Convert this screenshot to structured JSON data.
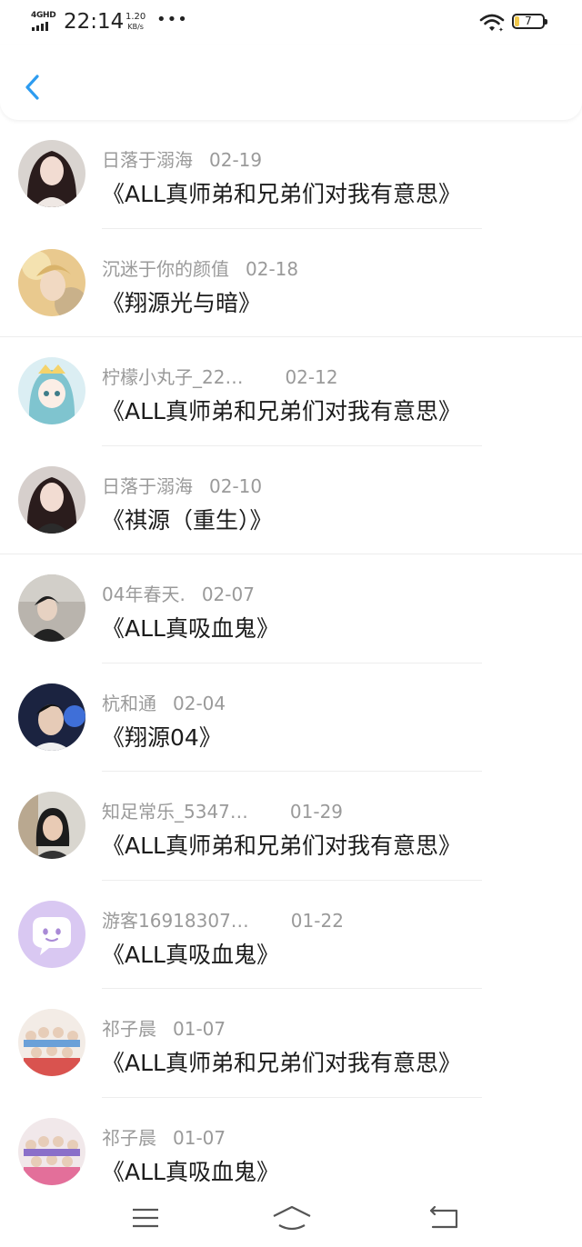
{
  "status_bar": {
    "network": "4GHD",
    "time": "22:14",
    "speed_value": "1.20",
    "speed_unit": "KB/s",
    "more_icon": "ellipsis-icon",
    "wifi_icon": "wifi-icon",
    "battery_level": "7"
  },
  "header": {
    "back_icon": "chevron-left-icon",
    "accent_color": "#2d9cf0"
  },
  "comments": [
    {
      "name": "日落于溺海",
      "date": "02-19",
      "title": "《ALL真师弟和兄弟们对我有意思》"
    },
    {
      "name": "沉迷于你的颜值",
      "date": "02-18",
      "title": "《翔源光与暗》"
    },
    {
      "name": "柠檬小丸子_22…",
      "date": "02-12",
      "title": "《ALL真师弟和兄弟们对我有意思》"
    },
    {
      "name": "日落于溺海",
      "date": "02-10",
      "title": "《祺源（重生）》"
    },
    {
      "name": "04年春天.",
      "date": "02-07",
      "title": "《ALL真吸血鬼》"
    },
    {
      "name": "杭和通",
      "date": "02-04",
      "title": "《翔源04》"
    },
    {
      "name": "知足常乐_5347…",
      "date": "01-29",
      "title": "《ALL真师弟和兄弟们对我有意思》"
    },
    {
      "name": "游客16918307…",
      "date": "01-22",
      "title": "《ALL真吸血鬼》"
    },
    {
      "name": "祁子晨",
      "date": "01-07",
      "title": "《ALL真师弟和兄弟们对我有意思》"
    },
    {
      "name": "祁子晨",
      "date": "01-07",
      "title": "《ALL真吸血鬼》"
    }
  ],
  "nav_bar": {
    "menu_icon": "menu-icon",
    "home_icon": "home-icon",
    "back_icon": "return-icon"
  }
}
